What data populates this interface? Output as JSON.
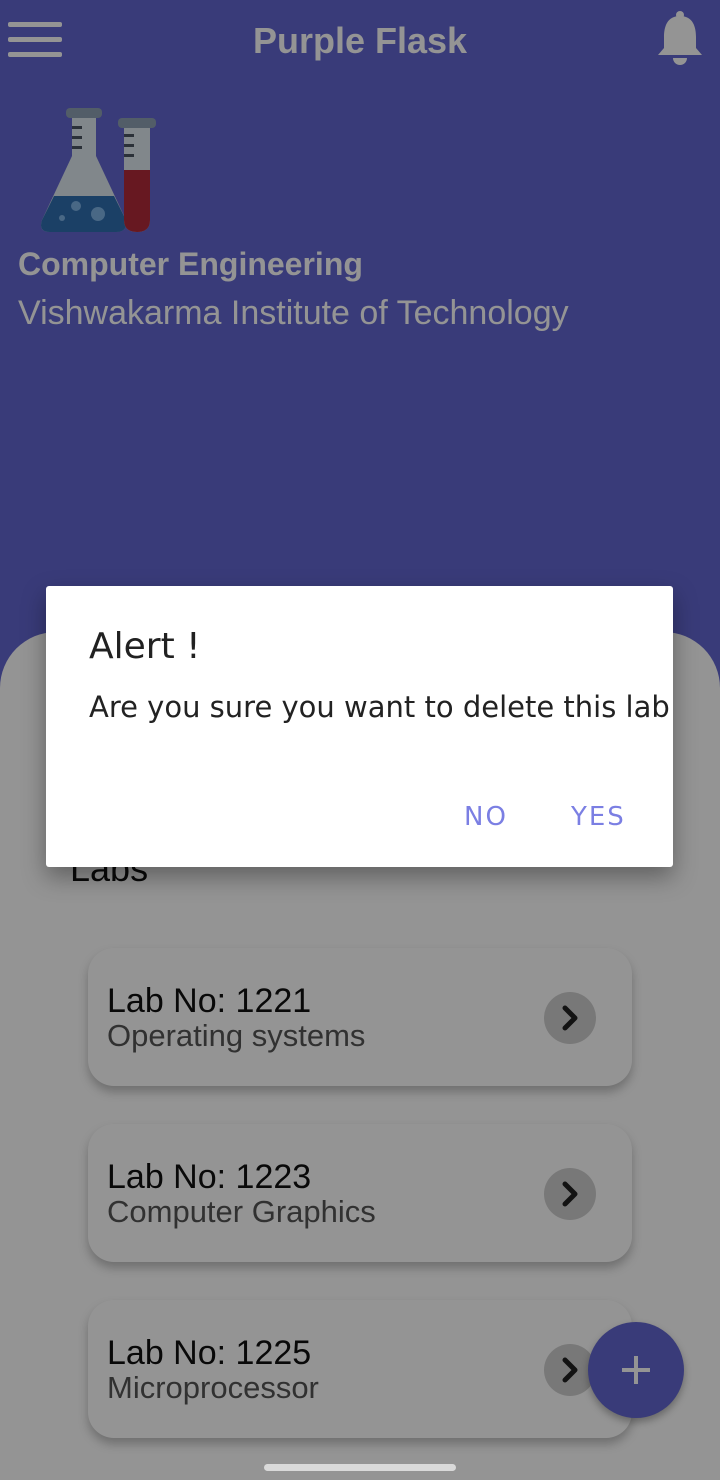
{
  "header": {
    "app_title": "Purple Flask",
    "department": "Computer Engineering",
    "institute": "Vishwakarma Institute of Technology",
    "logo_icon": "lab-flasks-icon",
    "menu_icon": "hamburger-menu-icon",
    "notification_icon": "bell-icon"
  },
  "main": {
    "section_title": "Labs",
    "labs": [
      {
        "number": "Lab No: 1221",
        "name": "Operating systems"
      },
      {
        "number": "Lab No: 1223",
        "name": "Computer Graphics"
      },
      {
        "number": "Lab No: 1225",
        "name": "Microprocessor"
      }
    ],
    "fab_icon": "plus-icon"
  },
  "dialog": {
    "title": "Alert !",
    "message": "Are you sure you want to delete this lab",
    "no_label": "NO",
    "yes_label": "YES"
  },
  "colors": {
    "primary": "#6366d0",
    "dialog_button": "#7b7fe3",
    "scrim": "rgba(0,0,0,0.42)"
  }
}
